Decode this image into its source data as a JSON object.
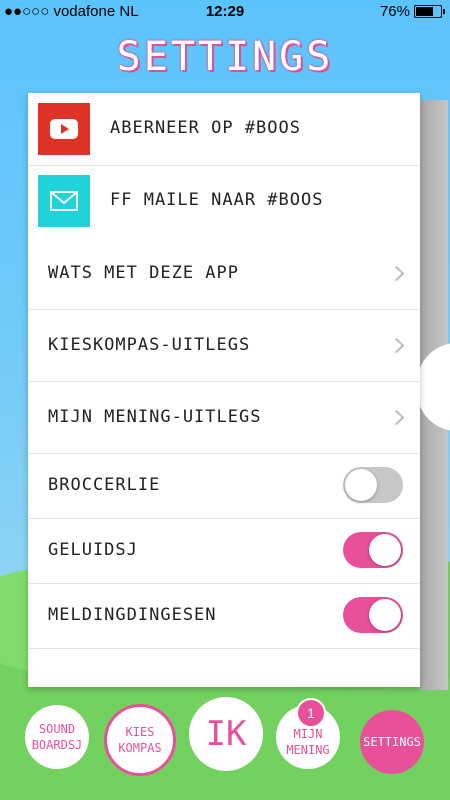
{
  "status_bar": {
    "carrier": "●●○○○ vodafone NL",
    "time": "12:29",
    "battery": "76%",
    "battery_level": 0.76
  },
  "header": {
    "title": "SETTINGS"
  },
  "menu": {
    "items": [
      {
        "label": "ABERNEER OP #BOOS",
        "icon": "youtube-icon",
        "color": "#e13228"
      },
      {
        "label": "FF MAILE NAAR #BOOS",
        "icon": "mail-icon",
        "color": "#1fd3d9"
      },
      {
        "label": "WATS MET DEZE APP"
      },
      {
        "label": "KIESKOMPAS-UITLEGS"
      },
      {
        "label": "MIJN MENING-UITLEGS"
      }
    ],
    "toggles": [
      {
        "label": "BROCCERLIE",
        "on": false
      },
      {
        "label": "GELUIDSJ",
        "on": true
      },
      {
        "label": "MELDINGDINGESEN",
        "on": true
      }
    ]
  },
  "bottom_nav": {
    "sound": "SOUND\nBOARDSJ",
    "kies": "KIES\nKOMPAS",
    "ik": "IK",
    "mijn": "MIJN\nMENING",
    "mijn_badge": "1",
    "settings": "SETTINGS"
  },
  "colors": {
    "accent": "#e8509a",
    "sky": "#5bc3fb",
    "grass": "#73d15f"
  }
}
